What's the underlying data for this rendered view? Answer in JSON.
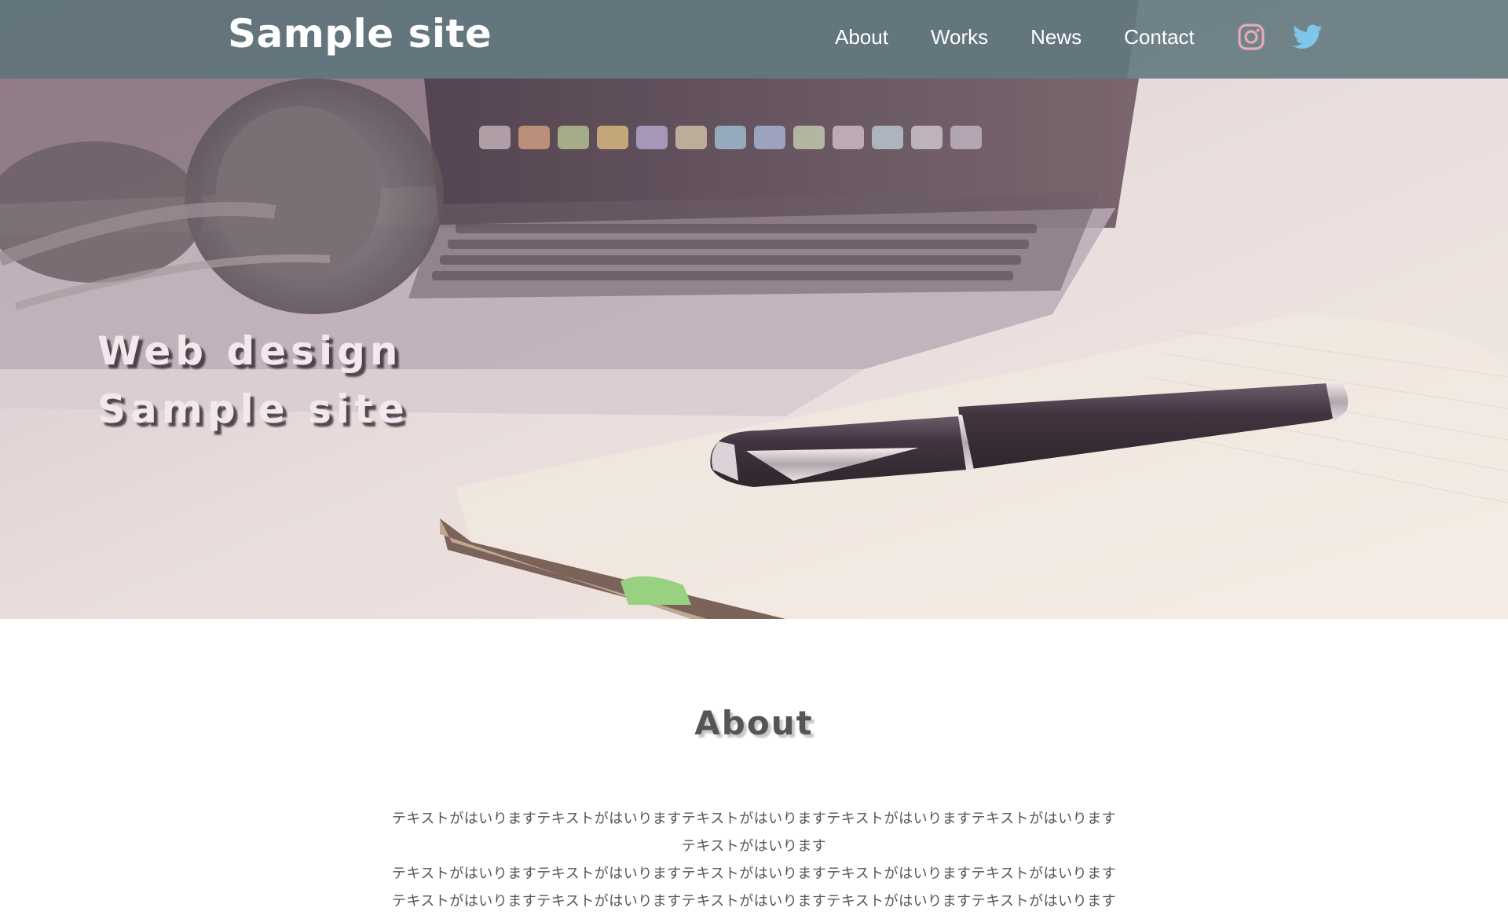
{
  "header": {
    "site_title": "Sample site",
    "nav": [
      {
        "label": "About"
      },
      {
        "label": "Works"
      },
      {
        "label": "News"
      },
      {
        "label": "Contact"
      }
    ],
    "social": [
      {
        "icon": "instagram-icon",
        "color": "#e8a9b8"
      },
      {
        "icon": "twitter-icon",
        "color": "#7fc6ea"
      }
    ],
    "background_color": "#5a737a"
  },
  "hero": {
    "line1": "Web design",
    "line2": "Sample site",
    "image": "laptop-headphones-notebook-pen-photo"
  },
  "about": {
    "heading": "About",
    "paragraphs": [
      "テキストがはいりますテキストがはいりますテキストがはいりますテキストがはいりますテキストがはいります",
      "テキストがはいります",
      "テキストがはいりますテキストがはいりますテキストがはいりますテキストがはいりますテキストがはいります",
      "テキストがはいりますテキストがはいりますテキストがはいりますテキストがはいりますテキストがはいります"
    ]
  }
}
